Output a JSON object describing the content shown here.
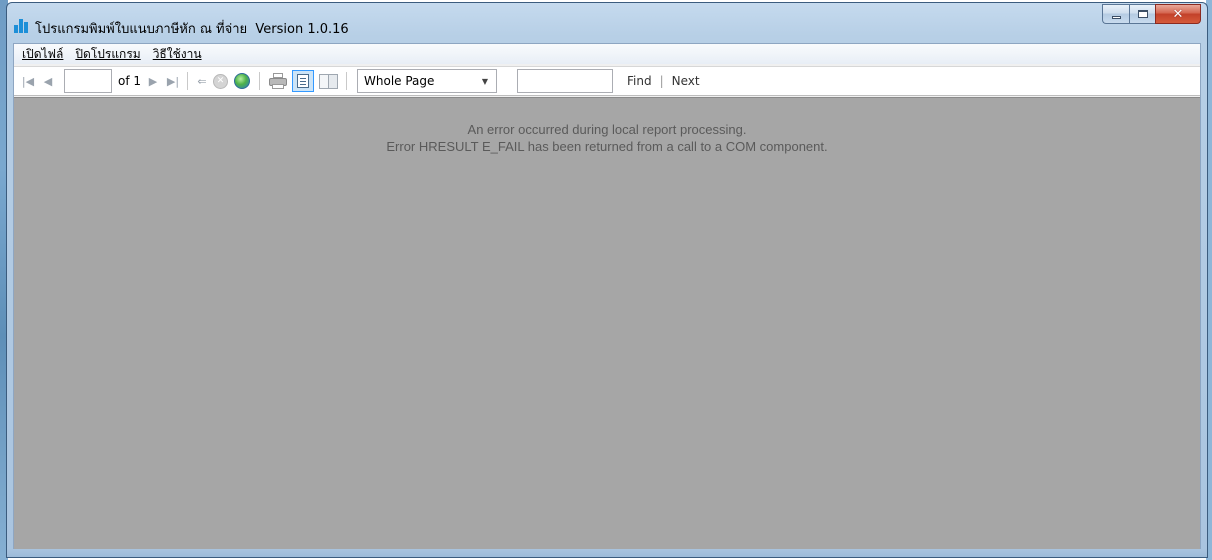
{
  "window": {
    "title": "โปรแกรมพิมพ์ใบแนบภาษีหัก ณ ที่จ่าย",
    "version": "Version 1.0.16"
  },
  "menu": {
    "items": [
      {
        "label": "เปิดไฟล์"
      },
      {
        "label": "ปิดโปรแกรม"
      },
      {
        "label": "วิธีใช้งาน"
      }
    ]
  },
  "toolbar": {
    "page_value": "",
    "of_text": "of 1",
    "zoom": "Whole Page",
    "find_value": "",
    "find_label": "Find",
    "separator": "|",
    "next_label": "Next"
  },
  "report": {
    "error_line1": "An error occurred during local report processing.",
    "error_line2": "Error HRESULT E_FAIL has been returned from a call to a COM component."
  },
  "colors": {
    "report_bg": "#a6a6a6",
    "app_icon": "#1c8fd8",
    "close_button": "#c2412a"
  }
}
